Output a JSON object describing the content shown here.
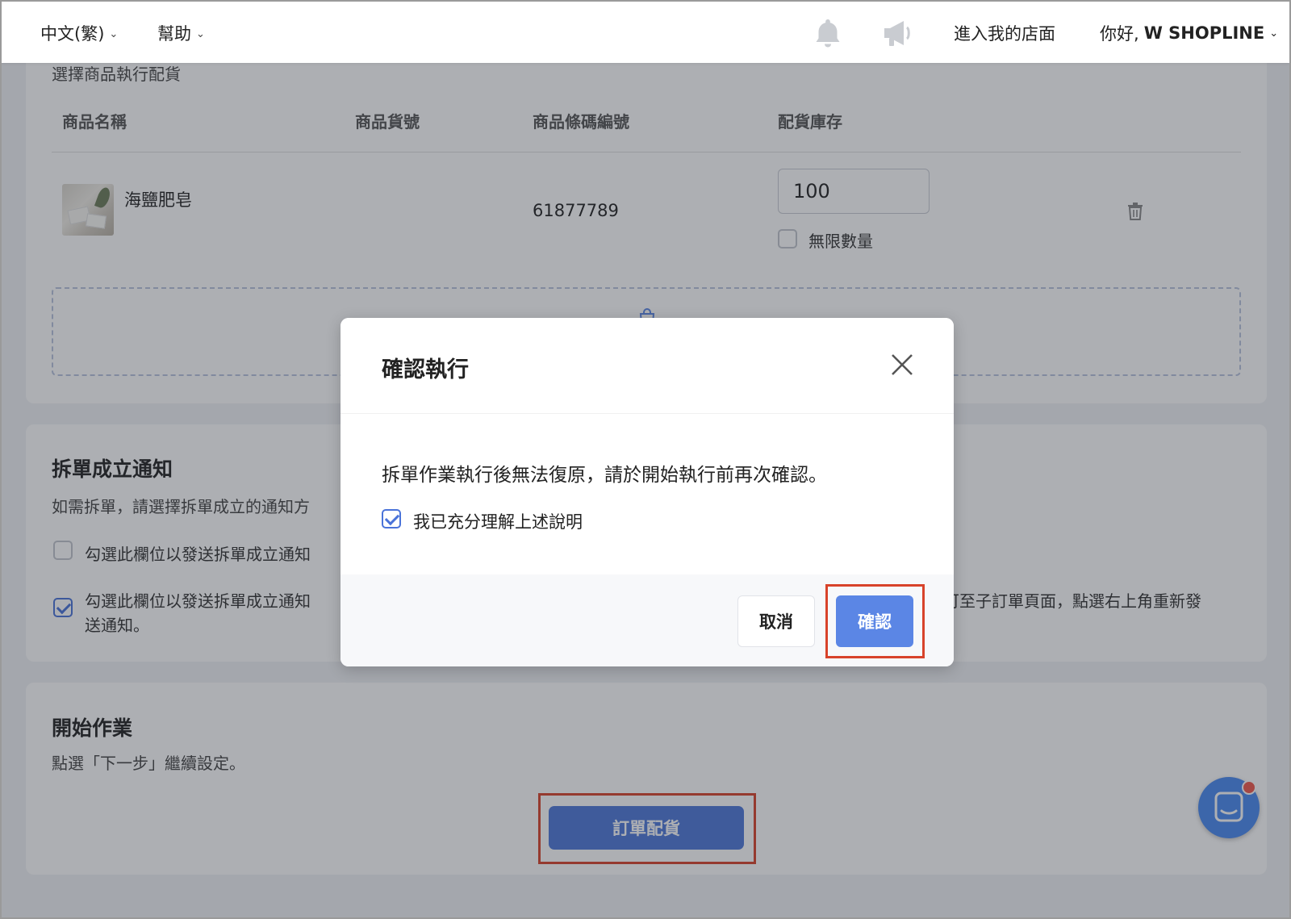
{
  "topbar": {
    "language": "中文(繁)",
    "help": "幫助",
    "storefront_link": "進入我的店面",
    "greeting": "你好,",
    "user_name": "W SHOPLINE"
  },
  "allocation": {
    "subtitle": "選擇商品執行配貨",
    "columns": [
      "商品名稱",
      "商品貨號",
      "商品條碼編號",
      "配貨庫存"
    ],
    "product": {
      "name": "海鹽肥皂",
      "barcode": "61877789",
      "stock": "100",
      "unlimited_label": "無限數量",
      "unlimited_checked": false
    }
  },
  "split_notice": {
    "title": "拆單成立通知",
    "description": "如需拆單，請選擇拆單成立的通知方",
    "option1": "勾選此欄位以發送拆單成立通知",
    "option2_line1_left": "勾選此欄位以發送拆單成立通知",
    "option2_line1_right": "可至子訂單頁面，點選右上角重新發",
    "option2_line2": "送通知。",
    "option1_checked": false,
    "option2_checked": true
  },
  "start": {
    "title": "開始作業",
    "description": "點選「下一步」繼續設定。",
    "button": "訂單配貨"
  },
  "dialog": {
    "title": "確認執行",
    "message": "拆單作業執行後無法復原，請於開始執行前再次確認。",
    "checkbox_label": "我已充分理解上述說明",
    "checkbox_checked": true,
    "cancel": "取消",
    "confirm": "確認"
  },
  "colors": {
    "primary": "#4e78d8",
    "highlight": "#d8432a",
    "chat": "#4a8af0"
  }
}
